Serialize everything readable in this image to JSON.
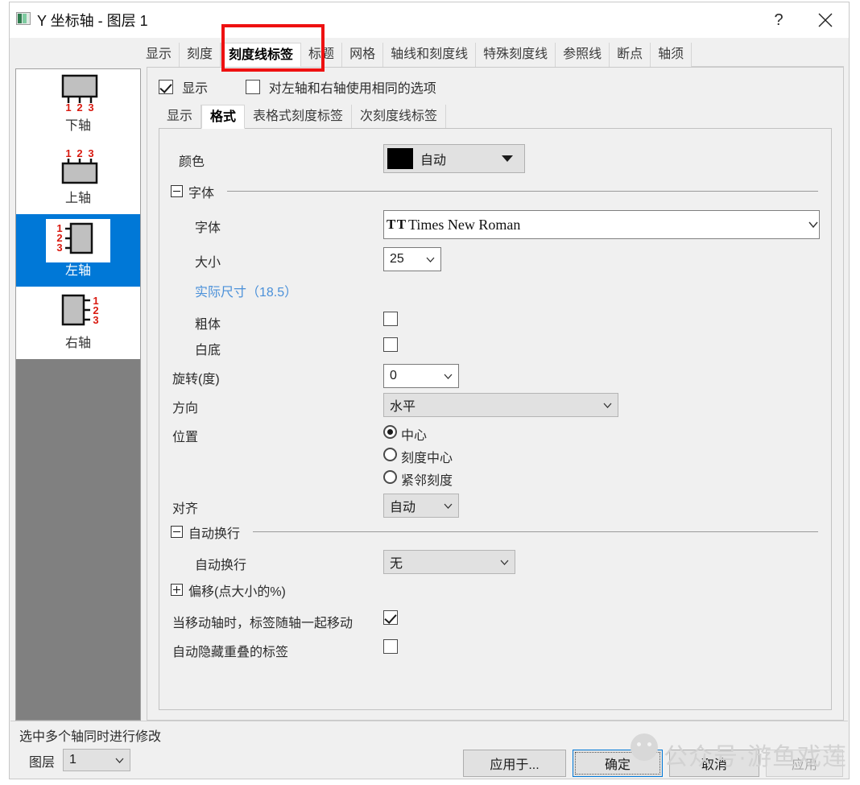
{
  "window": {
    "title": "Y 坐标轴 - 图层 1",
    "icon": "axis-dialog-icon",
    "help_label": "?",
    "close_label": "✕"
  },
  "annotation": {
    "color": "#ee1111",
    "target": "刻度线标签"
  },
  "watermark": {
    "text": "公众号·游鱼戏莲"
  },
  "sidebar": {
    "items": [
      {
        "label": "下轴",
        "icon": "axis-bottom-icon",
        "selected": false
      },
      {
        "label": "上轴",
        "icon": "axis-top-icon",
        "selected": false
      },
      {
        "label": "左轴",
        "icon": "axis-left-icon",
        "selected": true
      },
      {
        "label": "右轴",
        "icon": "axis-right-icon",
        "selected": false
      }
    ],
    "tick_digits": [
      "1",
      "2",
      "3"
    ],
    "tick_color": "#d91a10"
  },
  "tabs": [
    {
      "label": "显示",
      "selected": false
    },
    {
      "label": "刻度",
      "selected": false
    },
    {
      "label": "刻度线标签",
      "selected": true
    },
    {
      "label": "标题",
      "selected": false
    },
    {
      "label": "网格",
      "selected": false
    },
    {
      "label": "轴线和刻度线",
      "selected": false
    },
    {
      "label": "特殊刻度线",
      "selected": false
    },
    {
      "label": "参照线",
      "selected": false
    },
    {
      "label": "断点",
      "selected": false
    },
    {
      "label": "轴须",
      "selected": false
    }
  ],
  "top_options": {
    "show": {
      "label": "显示",
      "checked": true
    },
    "same_for_left_right": {
      "label": "对左轴和右轴使用相同的选项",
      "checked": false
    }
  },
  "inner_tabs": [
    {
      "label": "显示",
      "selected": false
    },
    {
      "label": "格式",
      "selected": true
    },
    {
      "label": "表格式刻度标签",
      "selected": false
    },
    {
      "label": "次刻度线标签",
      "selected": false
    }
  ],
  "form": {
    "color": {
      "label": "颜色",
      "value": "自动",
      "swatch": "#000000"
    },
    "font_group": {
      "label": "字体",
      "expanded": true
    },
    "font": {
      "label": "字体",
      "value": "Times New Roman",
      "icon": "font-T-icon"
    },
    "size": {
      "label": "大小",
      "value": "25"
    },
    "actual_size_link": "实际尺寸（18.5）",
    "bold": {
      "label": "粗体",
      "checked": false
    },
    "white_background": {
      "label": "白底",
      "checked": false
    },
    "rotation": {
      "label": "旋转(度)",
      "value": "0"
    },
    "direction": {
      "label": "方向",
      "value": "水平"
    },
    "position": {
      "label": "位置",
      "options": [
        {
          "label": "中心",
          "selected": true
        },
        {
          "label": "刻度中心",
          "selected": false
        },
        {
          "label": "紧邻刻度",
          "selected": false
        }
      ]
    },
    "align": {
      "label": "对齐",
      "value": "自动"
    },
    "wrap_group": {
      "label": "自动换行",
      "expanded": true
    },
    "wrap": {
      "label": "自动换行",
      "value": "无"
    },
    "offset_group": {
      "label": "偏移(点大小的%)",
      "expanded": false
    },
    "move_with_axis": {
      "label": "当移动轴时，标签随轴一起移动",
      "checked": true
    },
    "auto_hide_overlap": {
      "label": "自动隐藏重叠的标签",
      "checked": false
    }
  },
  "footer": {
    "status": "选中多个轴同时进行修改",
    "layer_label": "图层",
    "layer_value": "1",
    "buttons": [
      {
        "label": "应用于...",
        "state": "normal"
      },
      {
        "label": "确定",
        "state": "focused"
      },
      {
        "label": "取消",
        "state": "normal"
      },
      {
        "label": "应用",
        "state": "disabled"
      }
    ]
  }
}
